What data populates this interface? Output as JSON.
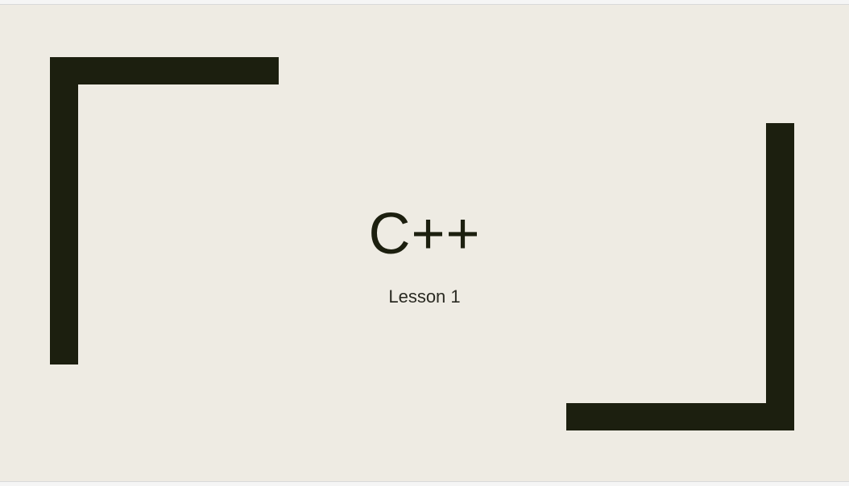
{
  "slide": {
    "title": "C++",
    "subtitle": "Lesson 1",
    "colors": {
      "background": "#eeebe3",
      "accent": "#1c1f0f",
      "text": "#1c1f0f"
    }
  }
}
